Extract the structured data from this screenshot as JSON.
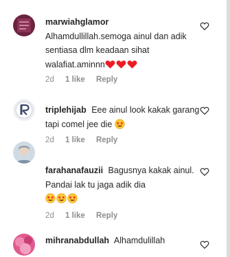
{
  "comments": [
    {
      "username": "marwiahglamor",
      "text": "Alhamdullillah.semoga ainul dan adik sentiasa dlm keadaan sihat walafiat.aminnn",
      "emoji": [
        "red-heart",
        "red-heart",
        "red-heart"
      ],
      "time": "2d",
      "likes": "1 like",
      "reply_label": "Reply",
      "avatar_color": "#6b2340"
    },
    {
      "username": "triplehijab",
      "text": "Eee ainul look kakak garang tapi comel jee die",
      "emoji": [
        "star-struck-face"
      ],
      "time": "2d",
      "likes": "1 like",
      "reply_label": "Reply",
      "avatar_color": "#e9ecef"
    },
    {
      "username": "farahanafauzii",
      "text": "Bagusnya kakak ainul. Pandai lak tu jaga adik dia",
      "emoji": [
        "star-struck-face",
        "star-struck-face",
        "star-struck-face"
      ],
      "time": "2d",
      "likes": "1 like",
      "reply_label": "Reply",
      "avatar_color": "#b9c9d6"
    },
    {
      "username": "mihranabdullah",
      "text": "Alhamdulillah",
      "emoji": [],
      "avatar_color": "#e05a8f"
    }
  ],
  "colors": {
    "text": "#262626",
    "muted": "#8e8e8e",
    "heart_red": "#ed1c24"
  }
}
